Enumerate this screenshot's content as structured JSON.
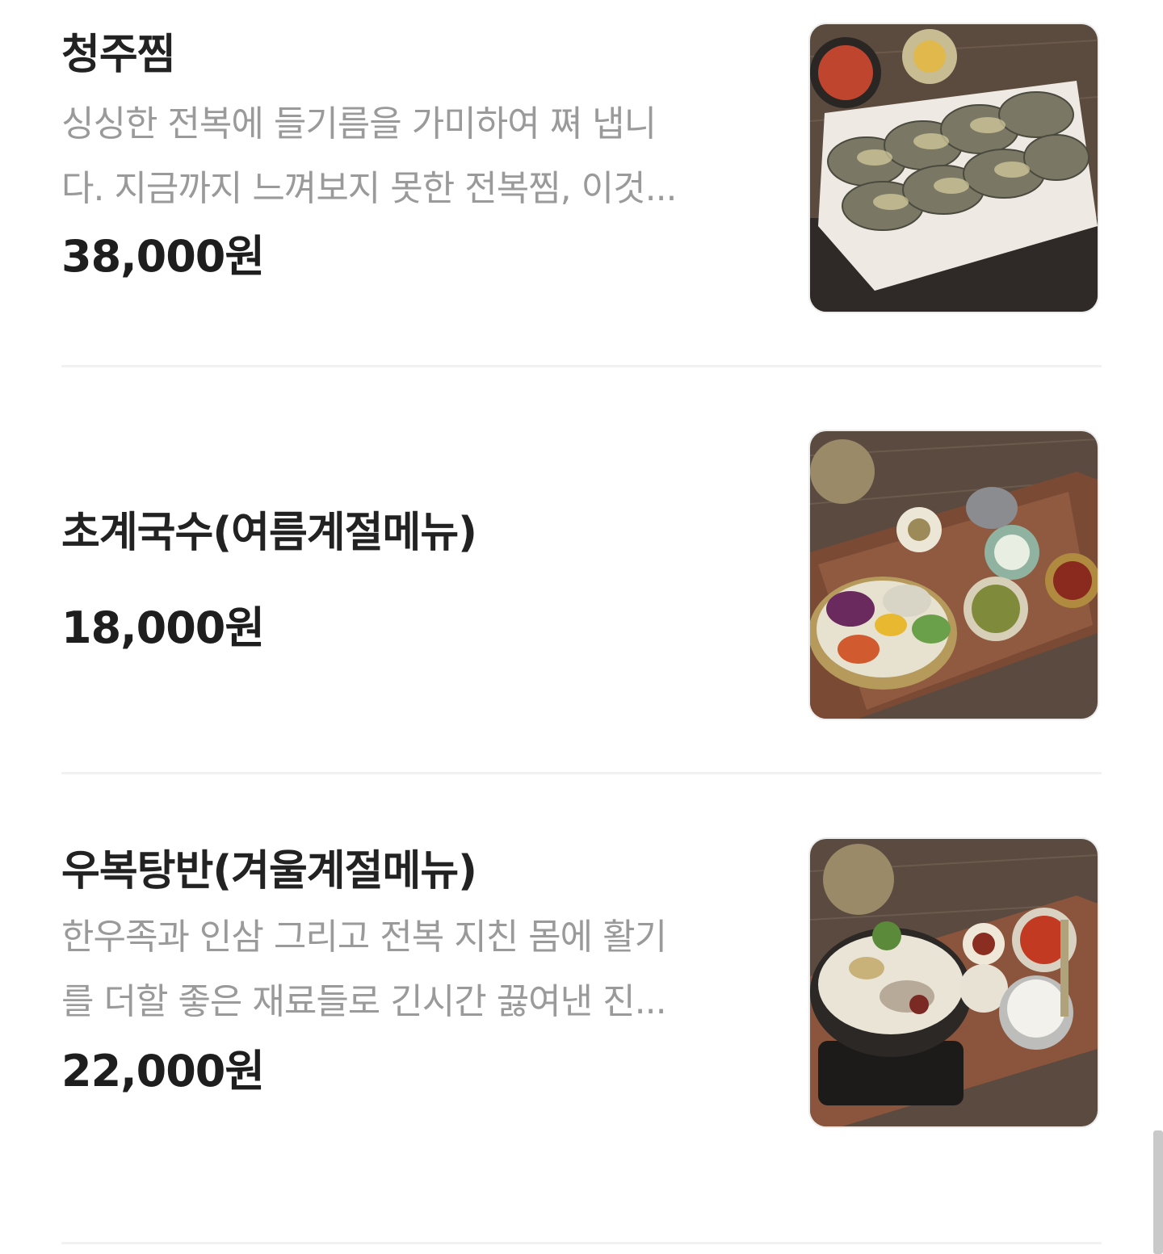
{
  "menu": {
    "items": [
      {
        "name": "청주찜",
        "desc_line1": "싱싱한 전복에 들기름을 가미하여 쪄 냅니",
        "desc_line2": "다. 지금까지 느껴보지 못한 전복찜, 이것...",
        "price": "38,000원",
        "image_icon": "braised-abalone-photo"
      },
      {
        "name": "초계국수(여름계절메뉴)",
        "price": "18,000원",
        "image_icon": "chogye-noodle-photo"
      },
      {
        "name": "우복탕반(겨울계절메뉴)",
        "desc_line1": "한우족과 인삼 그리고 전복 지친 몸에 활기",
        "desc_line2": "를 더할 좋은 재료들로 긴시간 끓여낸 진...",
        "price": "22,000원",
        "image_icon": "ubok-soup-photo"
      }
    ]
  }
}
